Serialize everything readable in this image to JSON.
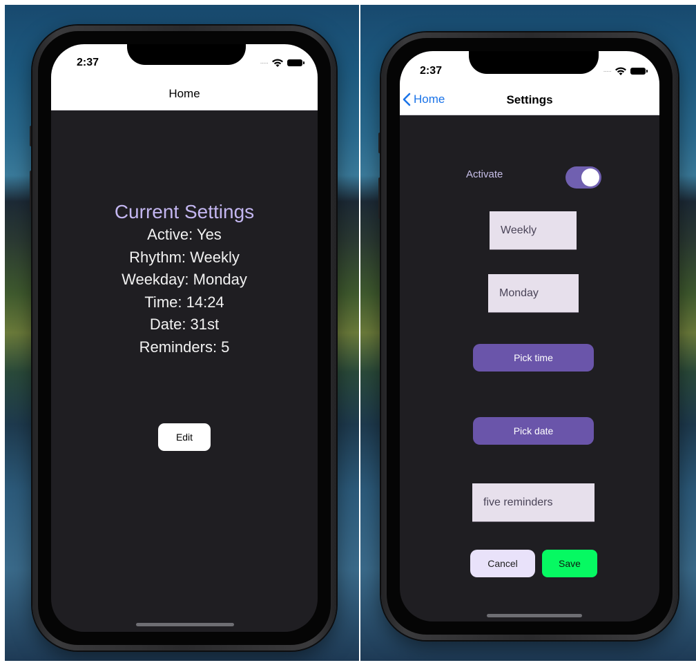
{
  "home_screen": {
    "status_time": "2:37",
    "nav_title": "Home",
    "heading": "Current Settings",
    "lines": [
      "Active: Yes",
      "Rhythm: Weekly",
      "Weekday: Monday",
      "Time: 14:24",
      "Date: 31st",
      "Reminders: 5"
    ],
    "edit_label": "Edit"
  },
  "settings_screen": {
    "status_time": "2:37",
    "back_label": "Home",
    "nav_title": "Settings",
    "activate_label": "Activate",
    "activate_on": true,
    "rhythm_value": "Weekly",
    "weekday_value": "Monday",
    "pick_time_label": "Pick time",
    "pick_date_label": "Pick date",
    "reminders_value": "five reminders",
    "cancel_label": "Cancel",
    "save_label": "Save"
  },
  "colors": {
    "screen_bg": "#1f1e22",
    "accent_purple": "#6a55aa",
    "heading_lavender": "#c3b6f0",
    "save_green": "#06f962",
    "back_blue": "#1a73e8"
  },
  "icons": [
    "chevron-left-icon",
    "wifi-icon",
    "battery-icon",
    "cellular-dots-icon"
  ]
}
